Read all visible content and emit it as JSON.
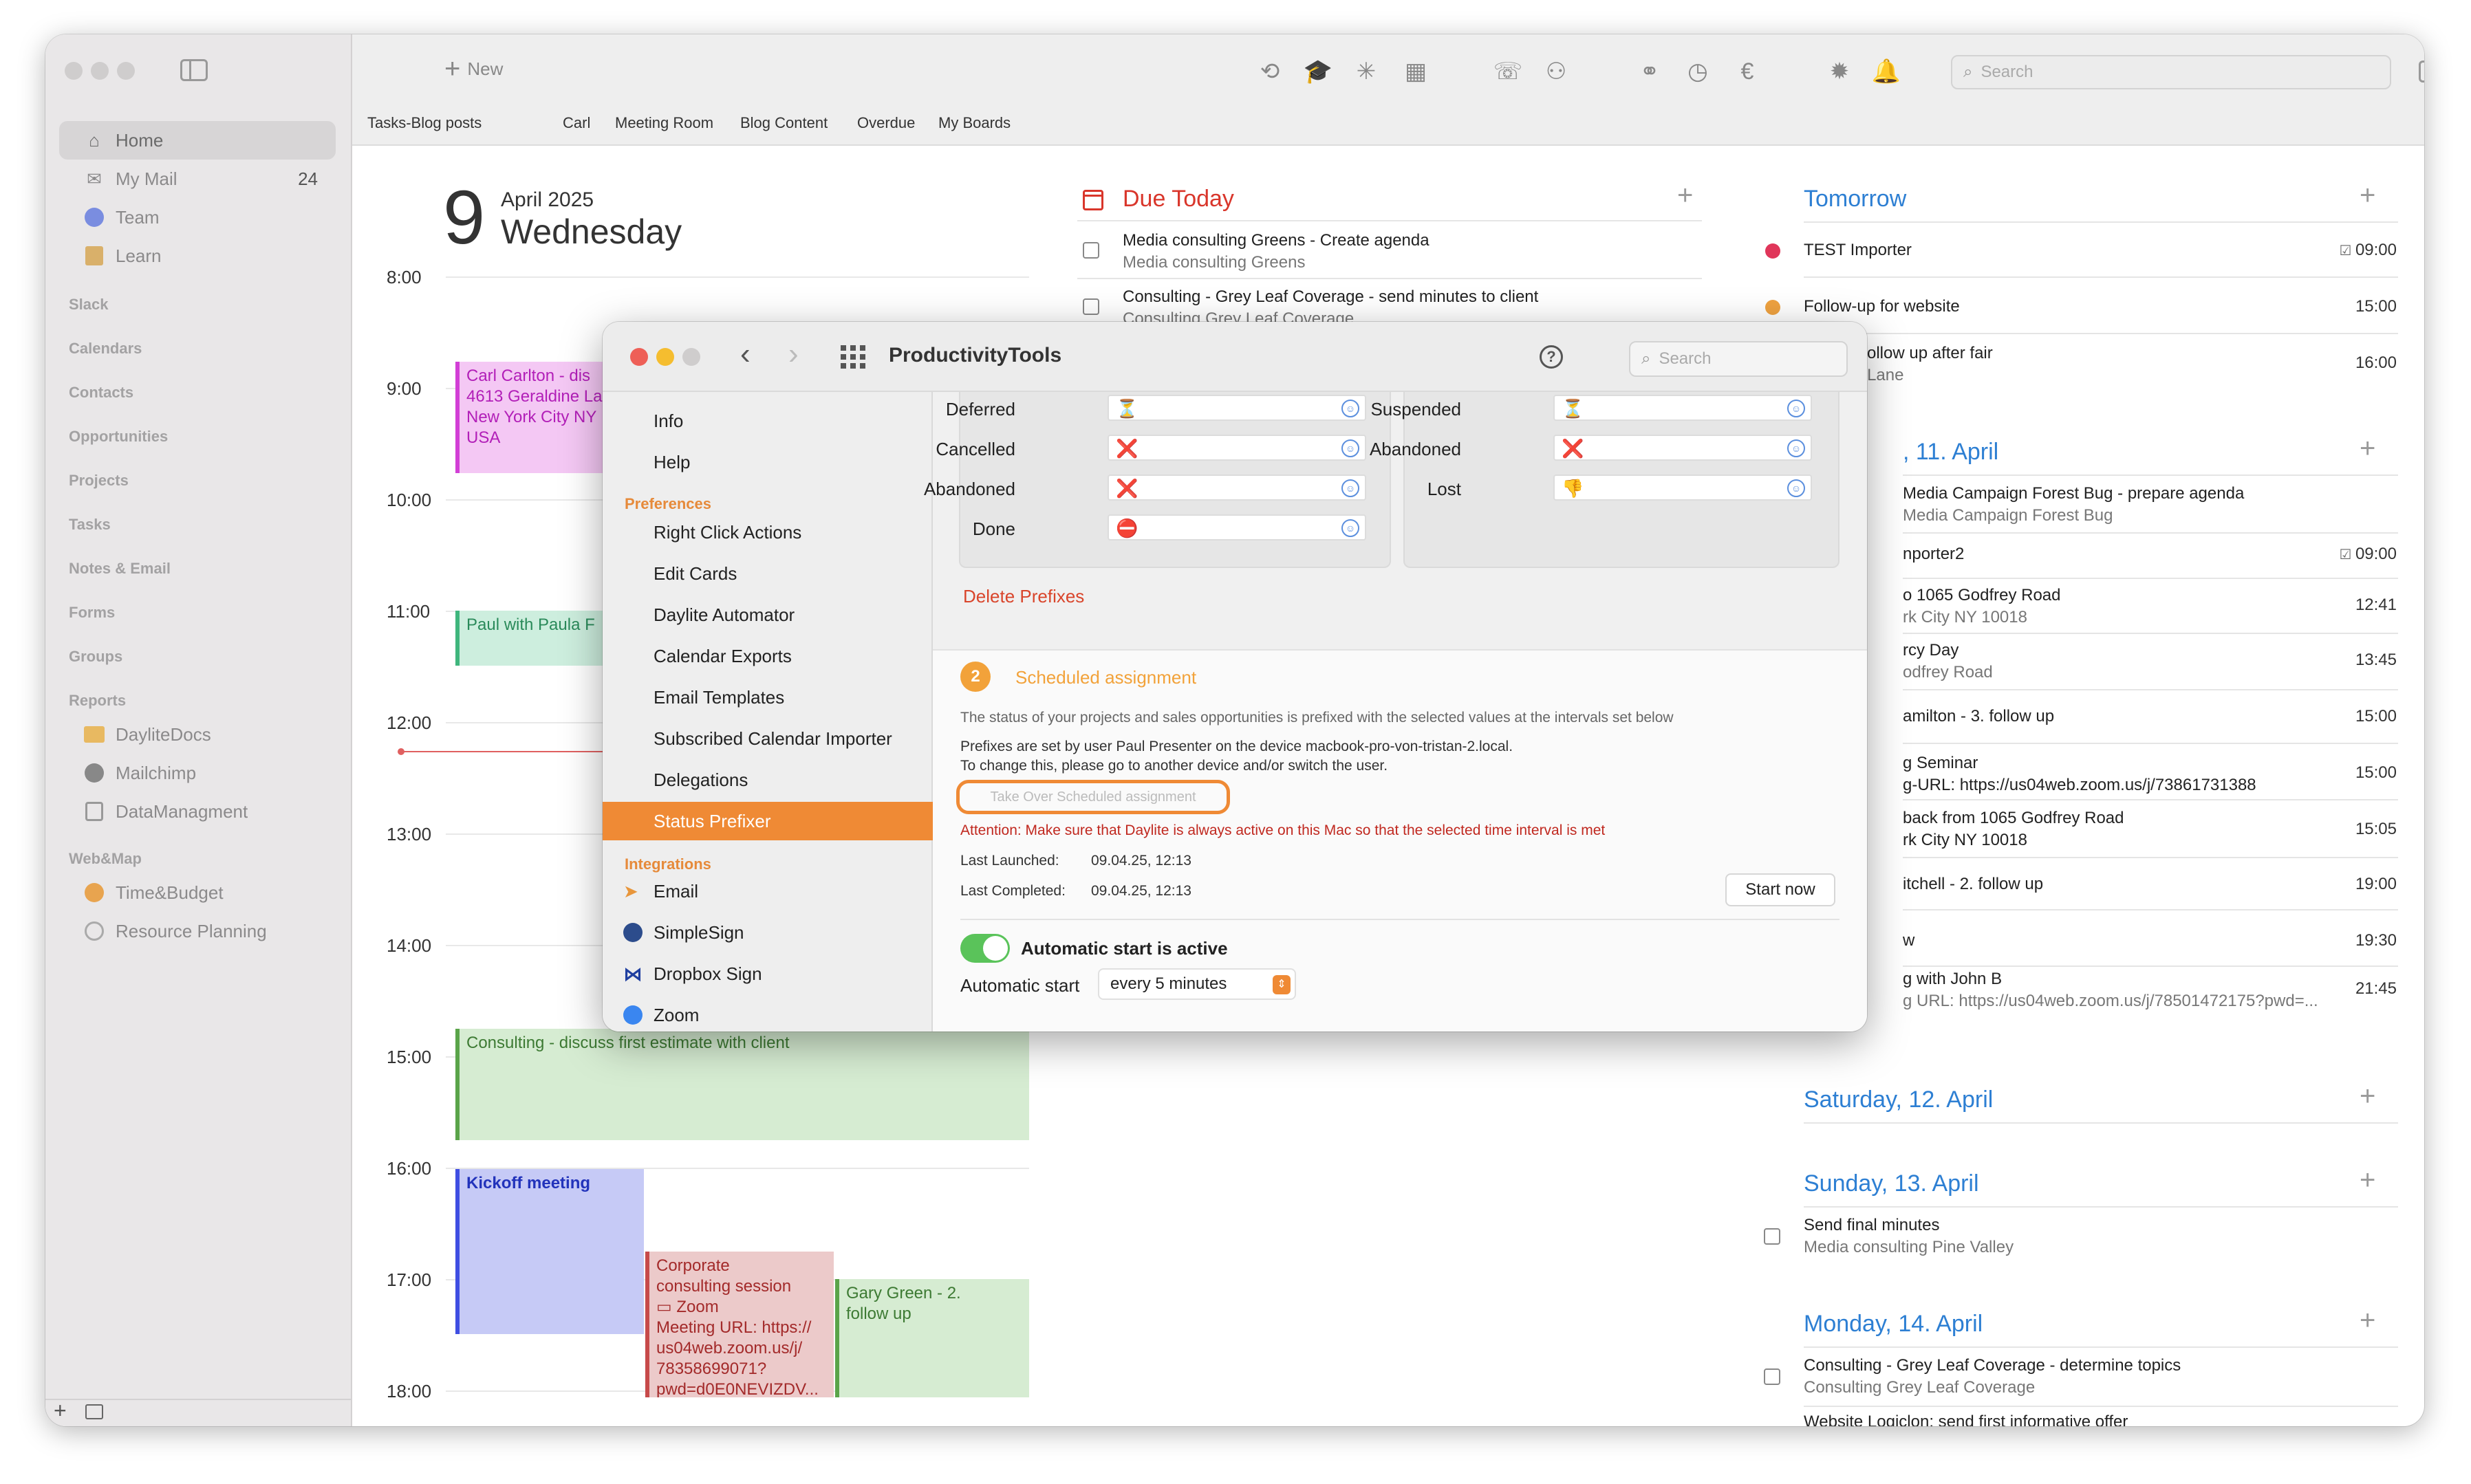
{
  "toolbar": {
    "new_label": "New",
    "search_placeholder": "Search",
    "tabs": [
      "Tasks-Blog posts",
      "Carl",
      "Meeting Room",
      "Blog Content",
      "Overdue",
      "My Boards"
    ]
  },
  "sidebar": {
    "items": [
      {
        "label": "Home",
        "icon": "house-icon"
      },
      {
        "label": "My Mail",
        "icon": "envelope-icon",
        "count": "24"
      },
      {
        "label": "Team",
        "icon": "team-icon"
      },
      {
        "label": "Learn",
        "icon": "book-icon"
      }
    ],
    "sections": [
      "Slack",
      "Calendars",
      "Contacts",
      "Opportunities",
      "Projects",
      "Tasks",
      "Notes & Email",
      "Forms",
      "Groups",
      "Reports"
    ],
    "reports": [
      "DayliteDocs",
      "Mailchimp",
      "DataManagment"
    ],
    "webmap_head": "Web&Map",
    "webmap": [
      "Time&Budget",
      "Resource Planning"
    ]
  },
  "calendar": {
    "day_number": "9",
    "month_year": "April 2025",
    "weekday": "Wednesday",
    "hours": [
      "8:00",
      "9:00",
      "10:00",
      "11:00",
      "12:00",
      "13:00",
      "14:00",
      "15:00",
      "16:00",
      "17:00",
      "18:00"
    ],
    "events": {
      "carl": [
        "Carl Carlton - dis",
        "4613 Geraldine La",
        "New York City  NY",
        "USA"
      ],
      "paul": "Paul with Paula F",
      "consulting": "Consulting - discuss first estimate with client",
      "kickoff": "Kickoff meeting",
      "corporate": [
        "Corporate",
        "consulting session",
        "Zoom",
        "Meeting URL: https://",
        "us04web.zoom.us/j/",
        "78358699071?",
        "pwd=d0E0NEVIZDV..."
      ],
      "gary": [
        "Gary Green - 2.",
        "follow up"
      ]
    }
  },
  "due_today": {
    "title": "Due Today",
    "items": [
      {
        "title": "Media consulting Greens - Create agenda",
        "sub": "Media consulting Greens"
      },
      {
        "title": "Consulting - Grey Leaf Coverage - send minutes to client",
        "sub": "Consulting Grey Leaf Coverage"
      }
    ]
  },
  "right": {
    "tomorrow": "Tomorrow",
    "tomorrow_items": [
      {
        "title": "TEST Importer",
        "time": "09:00",
        "color": "#e0365a"
      },
      {
        "title": "Follow-up for website",
        "time": "15:00",
        "color": "#efa240"
      },
      {
        "title": "liams - Follow up after fair",
        "sub": "eraldine Lane",
        "time": "16:00"
      }
    ],
    "friday": ", 11. April",
    "friday_items": [
      {
        "title": "Media Campaign Forest Bug - prepare agenda",
        "sub": "Media Campaign Forest Bug"
      },
      {
        "title": "nporter2",
        "time": "09:00"
      },
      {
        "title": "o 1065 Godfrey Road",
        "sub": "rk City  NY 10018",
        "time": "12:41"
      },
      {
        "title": "rcy Day",
        "sub": "odfrey Road",
        "time": "13:45"
      },
      {
        "title": "amilton - 3. follow up",
        "time": "15:00"
      },
      {
        "title": "g Seminar",
        "sub": "g-URL: https://us04web.zoom.us/j/73861731388",
        "time": "15:00"
      },
      {
        "title": "back from 1065 Godfrey Road",
        "sub": "rk City  NY 10018",
        "time": "15:05"
      },
      {
        "title": "itchell - 2. follow up",
        "time": "19:00"
      },
      {
        "title": "w",
        "time": "19:30"
      },
      {
        "title": "g with John B",
        "sub": "g URL: https://us04web.zoom.us/j/78501472175?pwd=...",
        "time": "21:45"
      }
    ],
    "saturday": "Saturday, 12. April",
    "sunday": "Sunday, 13. April",
    "sunday_items": [
      {
        "title": "Send final minutes",
        "sub": "Media consulting Pine Valley"
      }
    ],
    "monday": "Monday, 14. April",
    "monday_items": [
      {
        "title": "Consulting - Grey Leaf Coverage - determine topics",
        "sub": "Consulting Grey Leaf Coverage"
      },
      {
        "title": "Website Logiclon: send first informative offer"
      }
    ]
  },
  "dialog": {
    "title": "ProductivityTools",
    "search_placeholder": "Search",
    "side_top": [
      "Info",
      "Help"
    ],
    "preferences_head": "Preferences",
    "preferences": [
      "Right Click Actions",
      "Edit Cards",
      "Daylite Automator",
      "Calendar Exports",
      "Email Templates",
      "Subscribed Calendar Importer",
      "Delegations",
      "Status Prefixer"
    ],
    "integrations_head": "Integrations",
    "integrations": [
      "Email",
      "SimpleSign",
      "Dropbox Sign",
      "Zoom"
    ],
    "prefix_left": [
      {
        "label": "Deferred",
        "emoji": "⏳"
      },
      {
        "label": "Cancelled",
        "emoji": "❌"
      },
      {
        "label": "Abandoned",
        "emoji": "❌"
      },
      {
        "label": "Done",
        "emoji": "⛔"
      }
    ],
    "prefix_right": [
      {
        "label": "Suspended",
        "emoji": "⏳"
      },
      {
        "label": "Abandoned",
        "emoji": "❌"
      },
      {
        "label": "Lost",
        "emoji": "👎"
      }
    ],
    "delete_prefixes": "Delete Prefixes",
    "step_number": "2",
    "step_title": "Scheduled assignment",
    "desc": "The status of your projects and sales opportunities is prefixed with the selected values at the intervals set below",
    "prefix_user": "Prefixes are set by user Paul Presenter on the device macbook-pro-von-tristan-2.local.",
    "change_hint": "To change this, please go to another device and/or switch the user.",
    "takeover_button": "Take Over Scheduled assignment",
    "attention": "Attention: Make sure that Daylite is always active on this Mac so that the selected time interval is met",
    "last_launched_label": "Last Launched:",
    "last_launched_value": "09.04.25, 12:13",
    "last_completed_label": "Last Completed:",
    "last_completed_value": "09.04.25, 12:13",
    "start_now": "Start now",
    "auto_active": "Automatic start is active",
    "auto_start_label": "Automatic start",
    "auto_start_value": "every 5 minutes"
  },
  "colors": {
    "accent_orange": "#ef8a35",
    "blue_title": "#2d7fd3",
    "due_red": "#d9362b",
    "toggle_green": "#5ac35a"
  }
}
